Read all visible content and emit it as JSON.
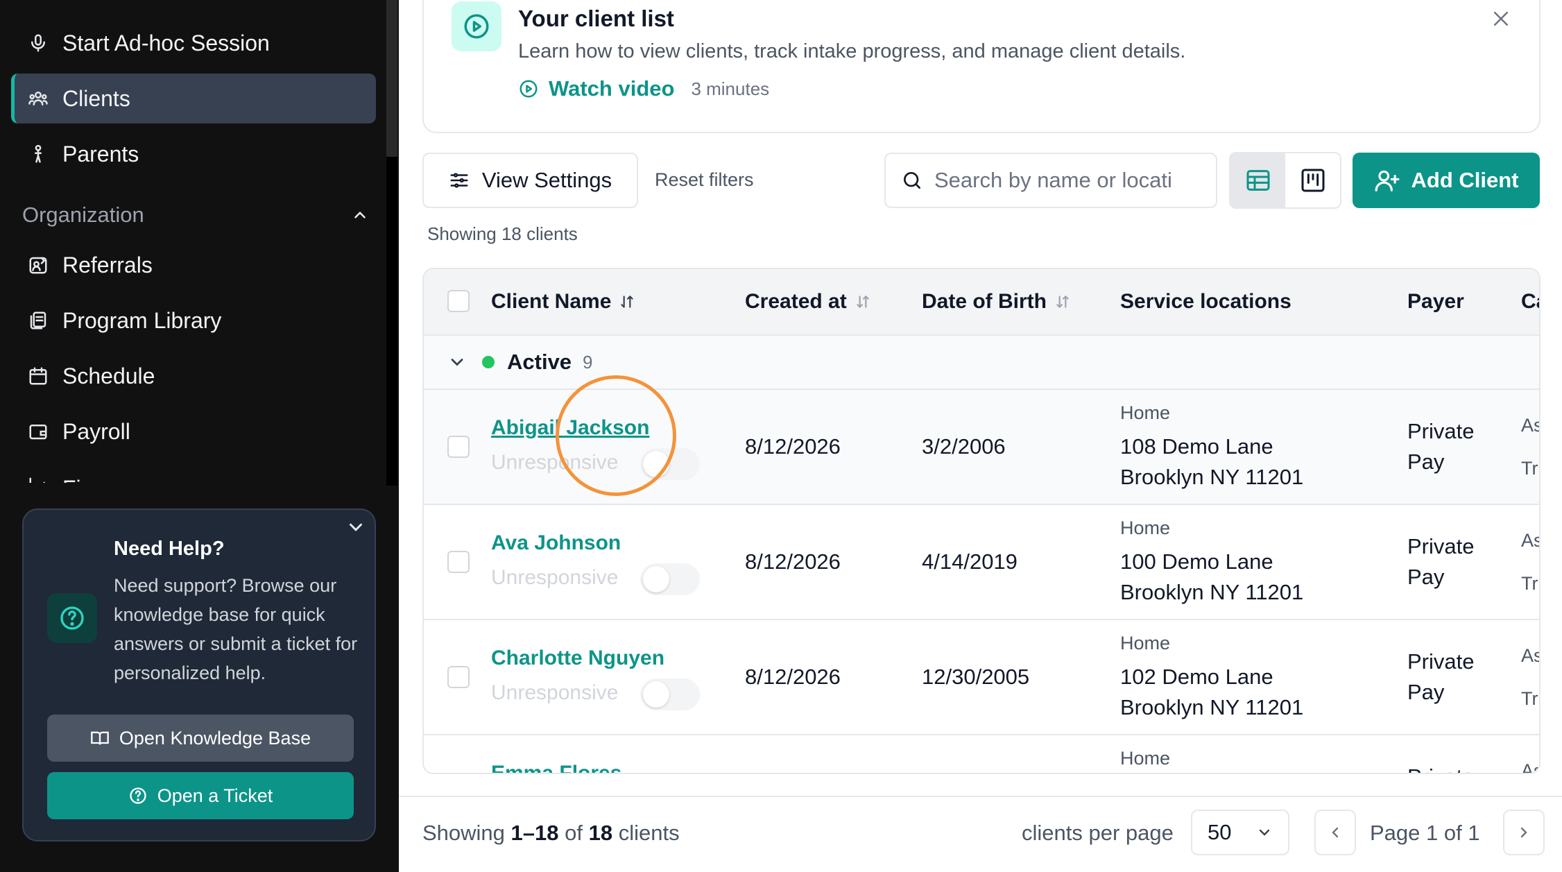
{
  "sidebar": {
    "items": [
      {
        "label": "Start Ad-hoc Session",
        "icon": "microphone-icon"
      },
      {
        "label": "Clients",
        "icon": "users-icon",
        "active": true
      },
      {
        "label": "Parents",
        "icon": "parent-icon"
      }
    ],
    "section": {
      "title": "Organization",
      "items": [
        {
          "label": "Referrals",
          "icon": "referral-icon"
        },
        {
          "label": "Program Library",
          "icon": "library-icon"
        },
        {
          "label": "Schedule",
          "icon": "calendar-icon"
        },
        {
          "label": "Payroll",
          "icon": "wallet-icon"
        },
        {
          "label": "Finances",
          "icon": "chart-icon"
        }
      ]
    },
    "help": {
      "title": "Need Help?",
      "text": "Need support? Browse our knowledge base for quick answers or submit a ticket for personalized help.",
      "kb_button": "Open Knowledge Base",
      "ticket_button": "Open a Ticket"
    }
  },
  "banner": {
    "title": "Your client list",
    "description": "Learn how to view clients, track intake progress, and manage client details.",
    "video_label": "Watch video",
    "duration": "3 minutes"
  },
  "toolbar": {
    "view_settings": "View Settings",
    "reset_filters": "Reset filters",
    "search_placeholder": "Search by name or locati",
    "add_client": "Add Client"
  },
  "summary": "Showing 18 clients",
  "table": {
    "columns": [
      "Client Name",
      "Created at",
      "Date of Birth",
      "Service locations",
      "Payer",
      "Ca"
    ],
    "group": {
      "label": "Active",
      "count": "9"
    },
    "rows": [
      {
        "name": "Abigail Jackson",
        "status": "Unresponsive",
        "created": "8/12/2026",
        "dob": "3/2/2006",
        "loc_label": "Home",
        "loc1": "108 Demo Lane",
        "loc2": "Brooklyn NY 11201",
        "payer1": "Private",
        "payer2": "Pay",
        "c1": "As",
        "c2": "Tr"
      },
      {
        "name": "Ava Johnson",
        "status": "Unresponsive",
        "created": "8/12/2026",
        "dob": "4/14/2019",
        "loc_label": "Home",
        "loc1": "100 Demo Lane",
        "loc2": "Brooklyn NY 11201",
        "payer1": "Private",
        "payer2": "Pay",
        "c1": "As",
        "c2": "Tr"
      },
      {
        "name": "Charlotte Nguyen",
        "status": "Unresponsive",
        "created": "8/12/2026",
        "dob": "12/30/2005",
        "loc_label": "Home",
        "loc1": "102 Demo Lane",
        "loc2": "Brooklyn NY 11201",
        "payer1": "Private",
        "payer2": "Pay",
        "c1": "As",
        "c2": "Tr"
      },
      {
        "name": "Emma Flores",
        "status": "",
        "created": "",
        "dob": "",
        "loc_label": "Home",
        "loc1": "",
        "loc2": "",
        "payer1": "Private",
        "payer2": "",
        "c1": "As",
        "c2": ""
      }
    ]
  },
  "footer": {
    "showing_prefix": "Showing",
    "range": "1–18",
    "of": "of",
    "total": "18",
    "suffix": "clients",
    "per_page_label": "clients per page",
    "per_page_value": "50",
    "page_label": "Page 1 of 1"
  },
  "colors": {
    "accent": "#0d9488",
    "sidebar": "#111111",
    "active_dot": "#22c55e",
    "cursor": "#f4933a"
  }
}
